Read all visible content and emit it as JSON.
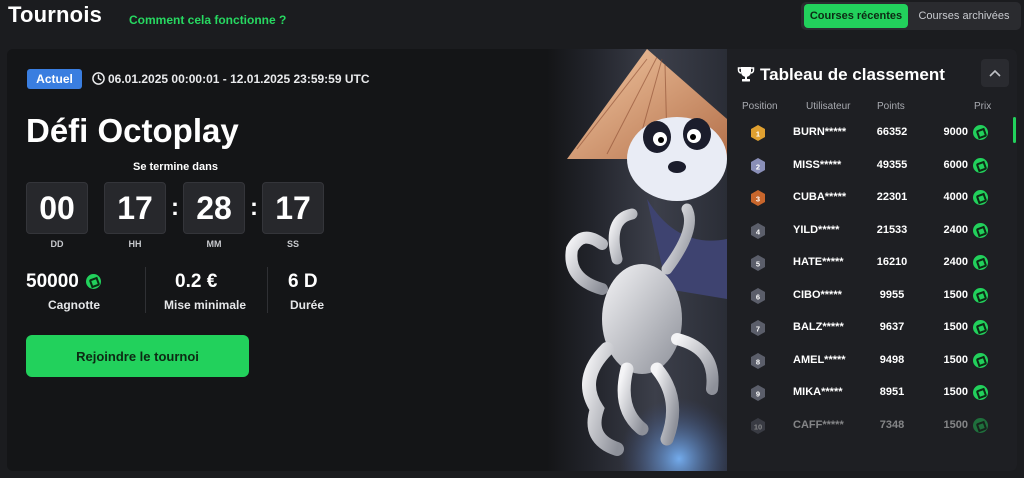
{
  "header": {
    "title": "Tournois",
    "how_link": "Comment cela fonctionne ?",
    "tabs": [
      {
        "label": "Courses récentes",
        "active": true
      },
      {
        "label": "Courses archivées",
        "active": false
      }
    ]
  },
  "tournament": {
    "status_badge": "Actuel",
    "date_range": "06.01.2025 00:00:01 - 12.01.2025 23:59:59 UTC",
    "name": "Défi Octoplay",
    "ends_label": "Se termine dans",
    "countdown": {
      "dd": "00",
      "hh": "17",
      "mm": "28",
      "ss": "17",
      "dd_label": "DD",
      "hh_label": "HH",
      "mm_label": "MM",
      "ss_label": "SS"
    },
    "stats": {
      "jackpot_value": "50000",
      "jackpot_label": "Cagnotte",
      "min_bet_value": "0.2 €",
      "min_bet_label": "Mise minimale",
      "duration_value": "6 D",
      "duration_label": "Durée"
    },
    "join_button": "Rejoindre le tournoi"
  },
  "leaderboard": {
    "title": "Tableau de classement",
    "columns": {
      "position": "Position",
      "user": "Utilisateur",
      "points": "Points",
      "prize": "Prix"
    },
    "rows": [
      {
        "rank": "1",
        "user": "BURN*****",
        "points": "66352",
        "prize": "9000",
        "medal": "gold"
      },
      {
        "rank": "2",
        "user": "MISS*****",
        "points": "49355",
        "prize": "6000",
        "medal": "silver"
      },
      {
        "rank": "3",
        "user": "CUBA*****",
        "points": "22301",
        "prize": "4000",
        "medal": "bronze"
      },
      {
        "rank": "4",
        "user": "YILD*****",
        "points": "21533",
        "prize": "2400",
        "medal": "plain"
      },
      {
        "rank": "5",
        "user": "HATE*****",
        "points": "16210",
        "prize": "2400",
        "medal": "plain"
      },
      {
        "rank": "6",
        "user": "CIBO*****",
        "points": "9955",
        "prize": "1500",
        "medal": "plain"
      },
      {
        "rank": "7",
        "user": "BALZ*****",
        "points": "9637",
        "prize": "1500",
        "medal": "plain"
      },
      {
        "rank": "8",
        "user": "AMEL*****",
        "points": "9498",
        "prize": "1500",
        "medal": "plain"
      },
      {
        "rank": "9",
        "user": "MIKA*****",
        "points": "8951",
        "prize": "1500",
        "medal": "plain"
      },
      {
        "rank": "10",
        "user": "CAFF*****",
        "points": "7348",
        "prize": "1500",
        "medal": "plain"
      }
    ]
  },
  "colors": {
    "accent_green": "#22d15c",
    "badge_blue": "#3a7ee0",
    "gold": "#e0a030",
    "silver": "#8a8fb8",
    "bronze": "#c8662c"
  }
}
